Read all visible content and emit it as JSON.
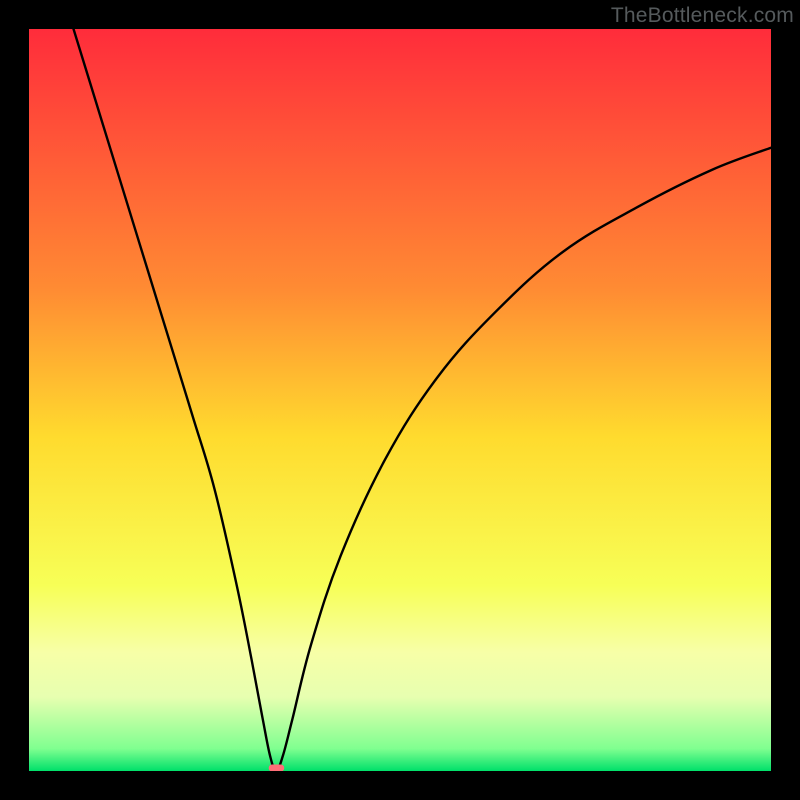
{
  "watermark": {
    "text": "TheBottleneck.com"
  },
  "chart_data": {
    "type": "line",
    "title": "",
    "xlabel": "",
    "ylabel": "",
    "xlim": [
      0,
      100
    ],
    "ylim": [
      0,
      100
    ],
    "grid": false,
    "legend": false,
    "background_gradient": {
      "stops": [
        {
          "offset": 0,
          "color": "#ff2c3b"
        },
        {
          "offset": 35,
          "color": "#ff8b33"
        },
        {
          "offset": 55,
          "color": "#ffdb2e"
        },
        {
          "offset": 75,
          "color": "#f7ff57"
        },
        {
          "offset": 84,
          "color": "#f7ffa7"
        },
        {
          "offset": 90,
          "color": "#e7ffb0"
        },
        {
          "offset": 97,
          "color": "#7fff90"
        },
        {
          "offset": 100,
          "color": "#00e06a"
        }
      ]
    },
    "curve": {
      "description": "V-shaped bottleneck curve; minimum near x≈33, rising steeply both sides",
      "points_xy": [
        [
          6,
          100
        ],
        [
          10,
          87
        ],
        [
          14,
          74
        ],
        [
          18,
          61
        ],
        [
          22,
          48
        ],
        [
          25,
          38
        ],
        [
          28,
          25
        ],
        [
          30,
          15
        ],
        [
          31.5,
          7
        ],
        [
          32.5,
          2
        ],
        [
          33.3,
          0
        ],
        [
          34.2,
          2
        ],
        [
          35.5,
          7
        ],
        [
          38,
          17
        ],
        [
          42,
          29
        ],
        [
          48,
          42
        ],
        [
          55,
          53
        ],
        [
          63,
          62
        ],
        [
          72,
          70
        ],
        [
          82,
          76
        ],
        [
          92,
          81
        ],
        [
          100,
          84
        ]
      ]
    },
    "marker": {
      "description": "small pink segment at curve minimum",
      "x_range": [
        32.3,
        34.4
      ],
      "y": 0.4,
      "color": "#ff6e78"
    }
  }
}
